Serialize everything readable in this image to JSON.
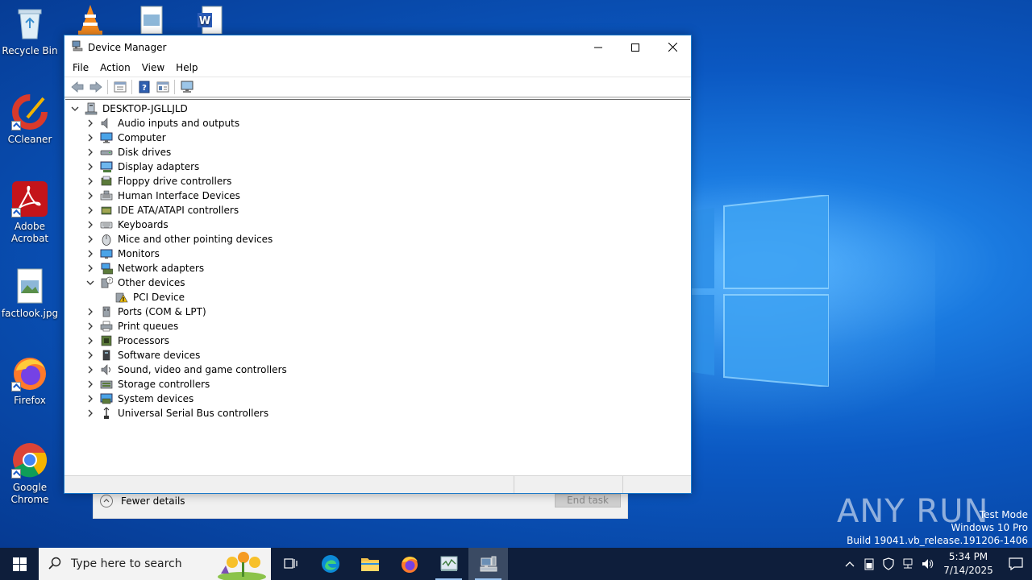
{
  "desktop": {
    "icons": [
      {
        "label": "Recycle Bin"
      },
      {
        "label": "CCleaner"
      },
      {
        "label": "Adobe Acrobat"
      },
      {
        "label": "factlook.jpg"
      },
      {
        "label": "Firefox"
      },
      {
        "label": "Google Chrome"
      }
    ]
  },
  "device_manager": {
    "title": "Device Manager",
    "menu": [
      "File",
      "Action",
      "View",
      "Help"
    ],
    "toolbar": [
      "back-icon",
      "forward-icon",
      "properties-icon",
      "help-icon",
      "update-driver-icon",
      "scan-hardware-icon"
    ],
    "root": "DESKTOP-JGLLJLD",
    "categories": [
      {
        "label": "Audio inputs and outputs",
        "expanded": false
      },
      {
        "label": "Computer",
        "expanded": false
      },
      {
        "label": "Disk drives",
        "expanded": false
      },
      {
        "label": "Display adapters",
        "expanded": false
      },
      {
        "label": "Floppy drive controllers",
        "expanded": false
      },
      {
        "label": "Human Interface Devices",
        "expanded": false
      },
      {
        "label": "IDE ATA/ATAPI controllers",
        "expanded": false
      },
      {
        "label": "Keyboards",
        "expanded": false
      },
      {
        "label": "Mice and other pointing devices",
        "expanded": false
      },
      {
        "label": "Monitors",
        "expanded": false
      },
      {
        "label": "Network adapters",
        "expanded": false
      },
      {
        "label": "Other devices",
        "expanded": true,
        "children": [
          "PCI Device"
        ]
      },
      {
        "label": "Ports (COM & LPT)",
        "expanded": false
      },
      {
        "label": "Print queues",
        "expanded": false
      },
      {
        "label": "Processors",
        "expanded": false
      },
      {
        "label": "Software devices",
        "expanded": false
      },
      {
        "label": "Sound, video and game controllers",
        "expanded": false
      },
      {
        "label": "Storage controllers",
        "expanded": false
      },
      {
        "label": "System devices",
        "expanded": false
      },
      {
        "label": "Universal Serial Bus controllers",
        "expanded": false
      }
    ]
  },
  "task_manager": {
    "fewer_details": "Fewer details",
    "end_task": "End task"
  },
  "watermark": {
    "brand": "ANY RUN",
    "line1": "Test Mode",
    "line2": "Windows 10 Pro",
    "line3": "Build 19041.vb_release.191206-1406"
  },
  "taskbar": {
    "search_placeholder": "Type here to search",
    "time": "5:34 PM",
    "date": "7/14/2025"
  },
  "colors": {
    "accent": "#1979ca",
    "taskbar": "#0e1e3b",
    "desktop": "#0b58c2"
  }
}
